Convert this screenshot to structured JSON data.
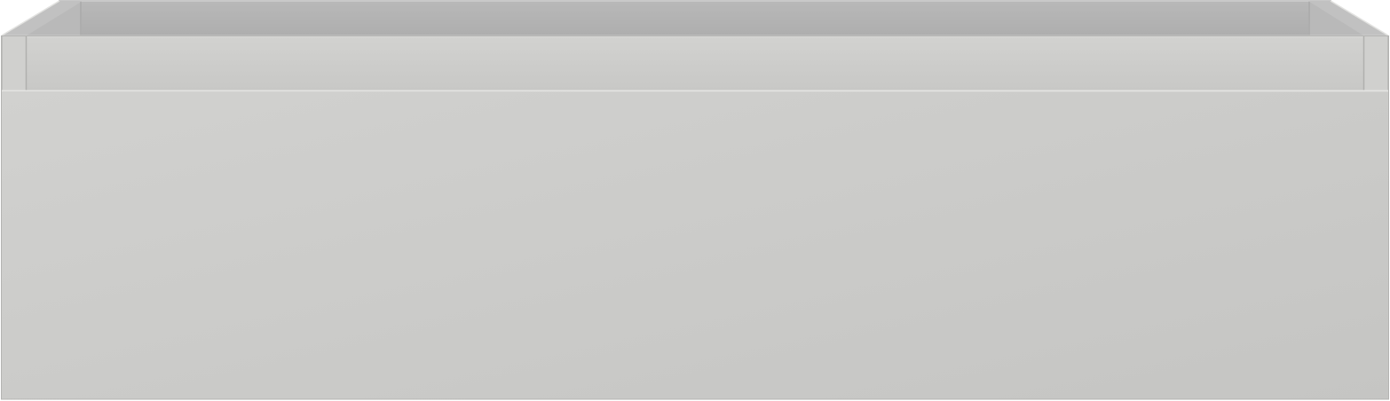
{
  "object": {
    "kind": "drawer-unit",
    "colors": {
      "background": "#ffffff",
      "front_panel": "#cbcbc9",
      "front_panel_light": "#d1d1cf",
      "front_panel_dark": "#c5c5c3",
      "rim_strip": "#cdcdcb",
      "inner_back_wall": "#b3b3b3",
      "inner_floor_shadow": "#a9a9a9",
      "side_wall": "#c1c1c1",
      "corner_post": "#d0d0ce",
      "edge_highlight": "#e6e6e4",
      "edge_line": "#a7a7a7"
    }
  }
}
